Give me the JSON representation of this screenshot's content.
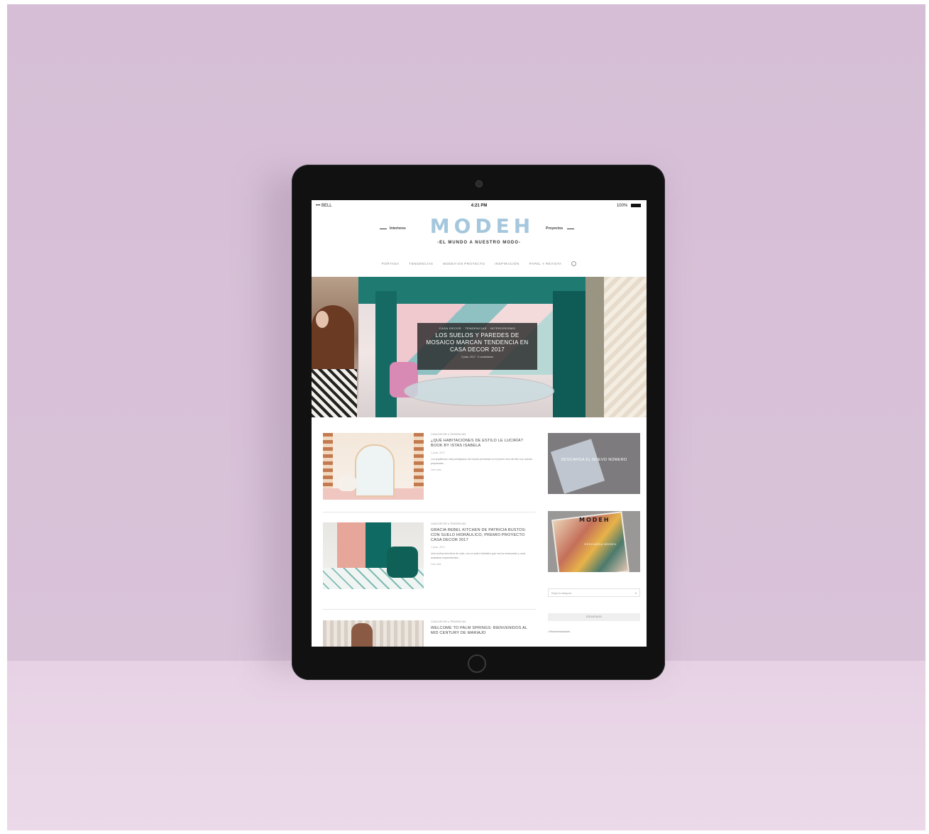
{
  "colors": {
    "wall": "#d6bfd6",
    "floor": "#e8d5e6",
    "logo_blue": "#a5c7dd",
    "device": "#111111"
  },
  "status_bar": {
    "carrier": "••• BELL",
    "time": "4:21 PM",
    "battery": "100%"
  },
  "masthead": {
    "left_word": "Interiores",
    "logo": "MODEH",
    "right_word": "Proyectos",
    "tagline": "-EL MUNDO A NUESTRO MODO-"
  },
  "nav": {
    "items": [
      "PORTADA",
      "TENDENCIAS",
      "MODEH EN PROYECTO",
      "INSPIRACIÓN",
      "PAPEL Y REVISTA"
    ],
    "search_icon": "search-icon"
  },
  "hero": {
    "category": "CASA DECOR · TENDENCIAS · INTERIORISMO",
    "title": "LOS SUELOS Y PAREDES DE MOSAICO MARCAN TENDENCIA EN CASA DECOR 2017",
    "meta": "2 junio, 2017 · 0 comentarios"
  },
  "posts": [
    {
      "meta": "CASA DECOR ● TENDENCIAS",
      "title": "¿QUÉ HABITACIONES DE ESTILO LE LUCIRÍA? BOOK BY ISTAS ISABELA",
      "date": "1 junio, 2017",
      "excerpt": "Los arquitectos más prestigiosos del mundo presentan en el primer mes del año sus nuevas propuestas...",
      "more": "Leer más"
    },
    {
      "meta": "CASA DECOR ● TENDENCIAS",
      "title": "GRACIA REBEL KITCHEN DE PATRICIA BUSTOS: CON SUELO HIDRÁULICO, PREMIO PROYECTO CASA DECOR 2017",
      "date": "1 junio, 2017",
      "excerpt": "Una cocina retro llena de color, con un suelo hidráulico que nos ha enamorado y unos acabados sorprendentes...",
      "more": "Leer más"
    },
    {
      "meta": "CASA DECOR ● TENDENCIAS",
      "title": "WELCOME TO PALM SPRINGS: BIENVENIDOS AL MID CENTURY DE MARIAJO",
      "date": "",
      "excerpt": "",
      "more": ""
    }
  ],
  "sidebar": {
    "promo1_text": "DESCARGA EL NUEVO NÚMERO",
    "promo2_logo": "MODEH",
    "promo2_text": "DESCARGA MODEH",
    "select_placeholder": "Elegir la categoría",
    "follow_button": "SÍGUENOS",
    "item": "• Recomendaciones"
  }
}
